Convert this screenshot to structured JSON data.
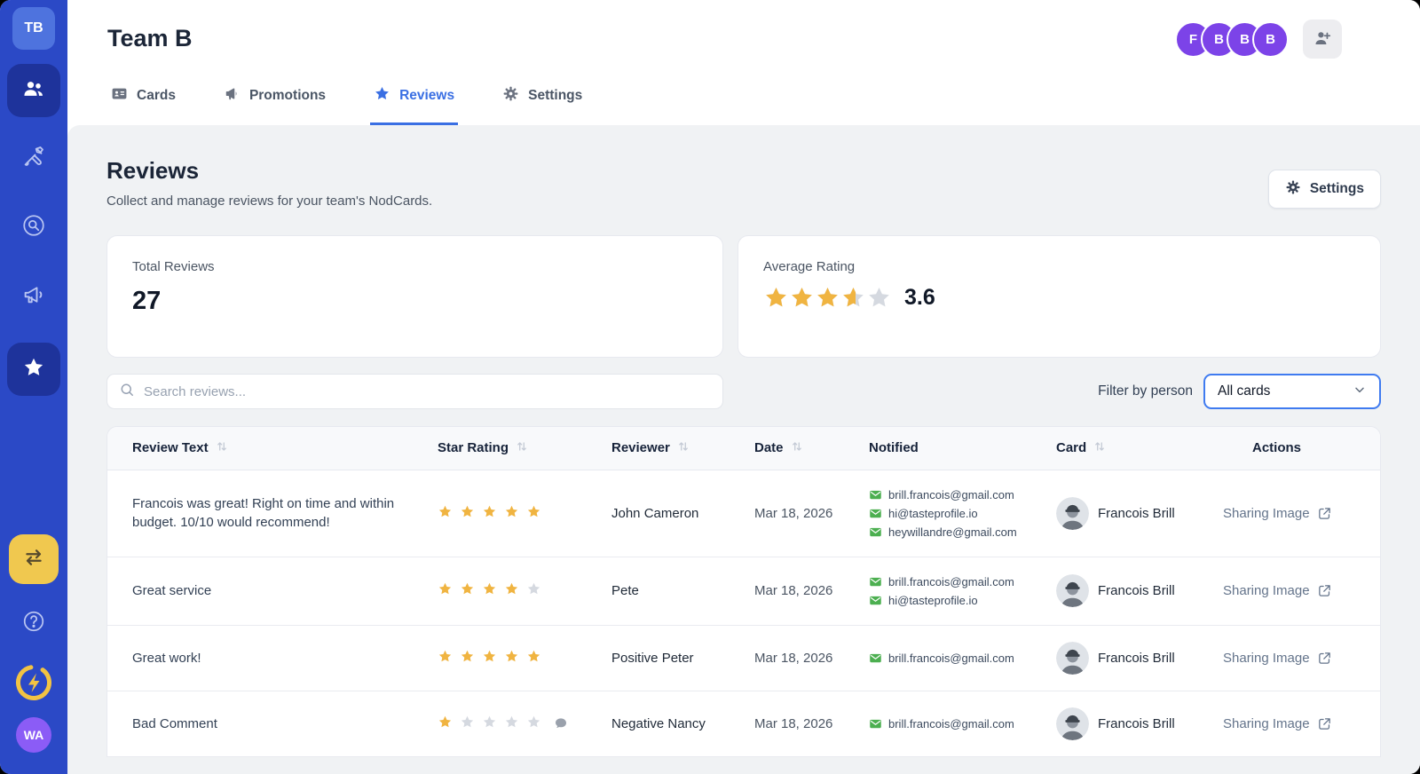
{
  "sidebar": {
    "workspace_initials": "TB",
    "user_initials": "WA"
  },
  "header": {
    "title": "Team B",
    "tabs": [
      {
        "label": "Cards",
        "active": false
      },
      {
        "label": "Promotions",
        "active": false
      },
      {
        "label": "Reviews",
        "active": true
      },
      {
        "label": "Settings",
        "active": false
      }
    ],
    "avatars": [
      "F",
      "B",
      "B",
      "B"
    ]
  },
  "page": {
    "title": "Reviews",
    "subtitle": "Collect and manage reviews for your team's NodCards.",
    "settings_button": "Settings"
  },
  "stats": {
    "total_reviews": {
      "label": "Total Reviews",
      "value": "27"
    },
    "average_rating": {
      "label": "Average Rating",
      "value": "3.6",
      "stars": 3.6
    }
  },
  "filters": {
    "search_placeholder": "Search reviews...",
    "filter_label": "Filter by person",
    "filter_value": "All cards"
  },
  "table": {
    "columns": [
      {
        "label": "Review Text",
        "sortable": true
      },
      {
        "label": "Star Rating",
        "sortable": true
      },
      {
        "label": "Reviewer",
        "sortable": true
      },
      {
        "label": "Date",
        "sortable": true
      },
      {
        "label": "Notified",
        "sortable": false
      },
      {
        "label": "Card",
        "sortable": true
      },
      {
        "label": "Actions",
        "sortable": false
      }
    ],
    "rows": [
      {
        "text": "Francois was great! Right on time and within budget. 10/10 would recommend!",
        "rating": 5,
        "has_comment": false,
        "reviewer": "John Cameron",
        "date": "Mar 18, 2026",
        "emails": [
          "brill.francois@gmail.com",
          "hi@tasteprofile.io",
          "heywillandre@gmail.com"
        ],
        "card_name": "Francois Brill",
        "action_label": "Sharing Image"
      },
      {
        "text": "Great service",
        "rating": 4,
        "has_comment": false,
        "reviewer": "Pete",
        "date": "Mar 18, 2026",
        "emails": [
          "brill.francois@gmail.com",
          "hi@tasteprofile.io"
        ],
        "card_name": "Francois Brill",
        "action_label": "Sharing Image"
      },
      {
        "text": "Great work!",
        "rating": 5,
        "has_comment": false,
        "reviewer": "Positive Peter",
        "date": "Mar 18, 2026",
        "emails": [
          "brill.francois@gmail.com"
        ],
        "card_name": "Francois Brill",
        "action_label": "Sharing Image"
      },
      {
        "text": "Bad Comment",
        "rating": 1,
        "has_comment": true,
        "reviewer": "Negative Nancy",
        "date": "Mar 18, 2026",
        "emails": [
          "brill.francois@gmail.com"
        ],
        "card_name": "Francois Brill",
        "action_label": "Sharing Image"
      }
    ]
  },
  "colors": {
    "sidebar_blue": "#2b49c6",
    "sidebar_active": "#1e339b",
    "accent_blue": "#3a6fe3",
    "star_amber": "#f0b441",
    "star_empty": "#d5d9e0",
    "avatar_purple": "#7c43e8",
    "user_purple": "#8b5cf6",
    "email_green": "#4caf50",
    "highlight_yellow": "#f0c84f"
  }
}
